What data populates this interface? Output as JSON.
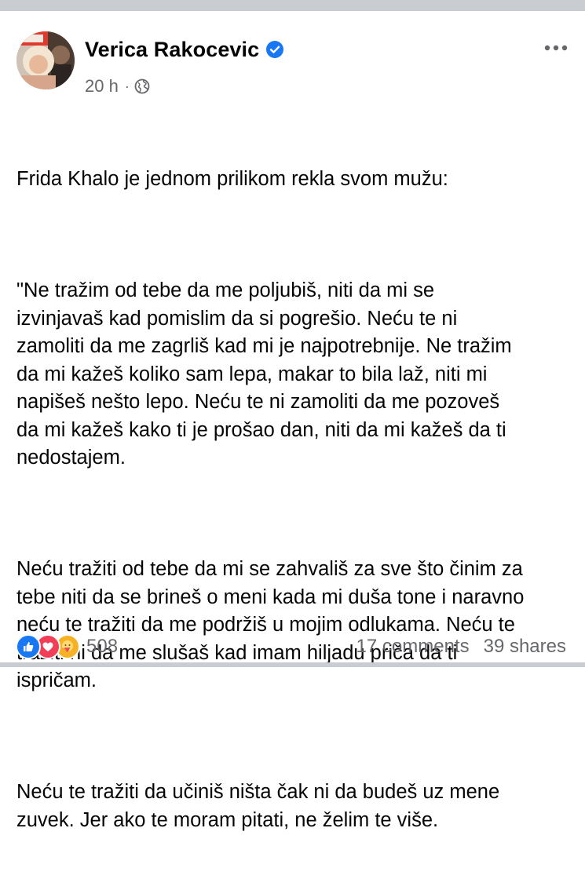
{
  "post": {
    "author": "Verica Rakocevic",
    "time": "20 h",
    "separator": "·",
    "verified_icon": "verified-badge-icon",
    "privacy_icon": "globe-icon",
    "paragraphs": [
      "Frida Khalo je jednom prilikom rekla svom mužu:",
      "\"Ne tražim od tebe da me poljubiš, niti da mi se\nizvinjavaš kad pomislim da si pogrešio. Neću te ni\nzamoliti da me zagrliš kad mi je najpotrebnije. Ne tražim\nda mi kažeš koliko sam lepa, makar to bila laž, niti mi\nnapišeš nešto lepo. Neću te ni zamoliti da me pozoveš\nda mi kažeš kako ti je prošao dan, niti da mi kažeš da ti\nnedostajem.",
      "Neću tražiti od tebe da mi se zahvališ za sve što činim za\ntebe niti da se brineš o meni kada mi duša tone i naravno\nneću te tražiti da me podržiš u mojim odlukama. Neću te\ntražiti ni da me slušaš kad imam hiljadu priča da ti\nispričam.",
      "Neću te tražiti da učiniš ništa čak ni da budeš uz mene\nzuvek. Jer ako te moram pitati, ne želim te više."
    ]
  },
  "footer": {
    "reaction_count": "508",
    "comments": "17 comments",
    "shares": "39 shares",
    "reaction_icons": [
      "like-icon",
      "love-icon",
      "care-icon"
    ]
  },
  "colors": {
    "text": "#050505",
    "secondary": "#65676b",
    "verified": "#1877f2",
    "like": "#1877f2",
    "love": "#f33e58",
    "care": "#f7b125",
    "divider": "#c9ccd1"
  }
}
